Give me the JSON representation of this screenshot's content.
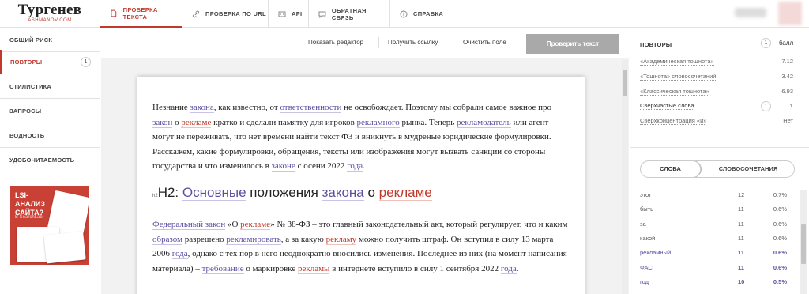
{
  "logo": {
    "title": "Тургенев",
    "subtitle": "ASHMANOV.COM"
  },
  "tabs": [
    {
      "label": "ПРОВЕРКА ТЕКСТА",
      "icon": "document-icon",
      "active": true
    },
    {
      "label": "ПРОВЕРКА ПО URL",
      "icon": "link-icon",
      "active": false
    },
    {
      "label": "API",
      "icon": "code-icon",
      "active": false
    },
    {
      "label": "ОБРАТНАЯ СВЯЗЬ",
      "icon": "chat-icon",
      "active": false
    },
    {
      "label": "СПРАВКА",
      "icon": "info-icon",
      "active": false
    }
  ],
  "sidebar": {
    "items": [
      {
        "label": "ОБЩИЙ РИСК",
        "active": false
      },
      {
        "label": "ПОВТОРЫ",
        "count": "1",
        "active": true
      },
      {
        "label": "СТИЛИСТИКА",
        "active": false
      },
      {
        "label": "ЗАПРОСЫ",
        "active": false
      },
      {
        "label": "ВОДНОСТЬ",
        "active": false
      },
      {
        "label": "УДОБОЧИТАЕМОСТЬ",
        "active": false
      }
    ],
    "promo": {
      "title": "LSI-АНАЛИЗ САЙТА?",
      "subtitle": "В SearchLab!"
    }
  },
  "toolbar": {
    "show_editor": "Показать редактор",
    "get_link": "Получить ссылку",
    "clear": "Очистить поле",
    "check": "Проверить текст"
  },
  "editor": {
    "p1": [
      [
        "Незнание ",
        ""
      ],
      [
        "закона",
        "b"
      ],
      [
        ", как известно, от ",
        ""
      ],
      [
        "ответственности",
        "b"
      ],
      [
        " не освобождает. Поэтому мы собрали самое важное про ",
        ""
      ],
      [
        "закон",
        "b"
      ],
      [
        " о ",
        ""
      ],
      [
        "рекламе",
        "r"
      ],
      [
        " кратко и сделали памятку для игроков ",
        ""
      ],
      [
        "рекламного",
        "b"
      ],
      [
        " рынка. Теперь ",
        ""
      ],
      [
        "рекламодатель",
        "b"
      ],
      [
        " или агент могут не переживать, что нет времени найти текст ФЗ и вникнуть в мудреные юридические формулировки. Расскажем, какие формулировки, обращения, тексты или изображения могут вызвать санкции со стороны государства и что изменилось в ",
        ""
      ],
      [
        "законе",
        "b"
      ],
      [
        " с осени 2022 ",
        ""
      ],
      [
        "года",
        "b"
      ],
      [
        ".",
        ""
      ]
    ],
    "h2_mark": "h2",
    "h2": [
      [
        "H2: ",
        ""
      ],
      [
        "Основные",
        "b"
      ],
      [
        " положения ",
        ""
      ],
      [
        "закона",
        "b"
      ],
      [
        " о ",
        ""
      ],
      [
        "рекламе",
        "r"
      ]
    ],
    "p2": [
      [
        "Федеральный закон",
        "b"
      ],
      [
        " «О ",
        ""
      ],
      [
        "рекламе",
        "r"
      ],
      [
        "» № 38-ФЗ – это главный законодательный акт, который регулирует, что и каким ",
        ""
      ],
      [
        "образом",
        "b"
      ],
      [
        " разрешено ",
        ""
      ],
      [
        "рекламировать",
        "b"
      ],
      [
        ", а за какую ",
        ""
      ],
      [
        "рекламу",
        "r"
      ],
      [
        " можно получить штраф. Он вступил в силу 13 марта 2006 ",
        ""
      ],
      [
        "года",
        "b"
      ],
      [
        ", однако с тех пор в него неоднократно вносились изменения. Последнее из них (на момент написания материала) – ",
        ""
      ],
      [
        "требование",
        "b"
      ],
      [
        " о маркировке ",
        ""
      ],
      [
        "рекламы",
        "r"
      ],
      [
        " в интернете вступило в силу 1 сентября 2022 ",
        ""
      ],
      [
        "года",
        "b"
      ],
      [
        ".",
        ""
      ]
    ]
  },
  "right": {
    "header": "ПОВТОРЫ",
    "header_count": "1",
    "header_unit": "балл",
    "metrics": [
      {
        "label": "«Академическая тошнота»",
        "value": "7.12"
      },
      {
        "label": "«Тошнота» словосочетаний",
        "value": "3.42"
      },
      {
        "label": "«Классическая тошнота»",
        "value": "6.93"
      },
      {
        "label": "Сверхчастые слова",
        "count": "1",
        "value": "1",
        "strong": true
      },
      {
        "label": "Сверхконцентрация «и»",
        "value": "Нет"
      }
    ],
    "toggle": {
      "words": "СЛОВА",
      "phrases": "СЛОВОСОЧЕТАНИЯ"
    },
    "words": [
      {
        "word": "этот",
        "count": "12",
        "pct": "0.7%",
        "hl": false
      },
      {
        "word": "быть",
        "count": "11",
        "pct": "0.6%",
        "hl": false
      },
      {
        "word": "за",
        "count": "11",
        "pct": "0.6%",
        "hl": false
      },
      {
        "word": "какой",
        "count": "11",
        "pct": "0.6%",
        "hl": false
      },
      {
        "word": "рекламный",
        "count": "11",
        "pct": "0.6%",
        "hl": true
      },
      {
        "word": "ФАС",
        "count": "11",
        "pct": "0.6%",
        "hl": true
      },
      {
        "word": "год",
        "count": "10",
        "pct": "0.5%",
        "hl": true
      }
    ]
  },
  "colors": {
    "accent": "#c0392b",
    "highlight_blue": "#5c4ea0",
    "button_gray": "#a9a9a9"
  }
}
